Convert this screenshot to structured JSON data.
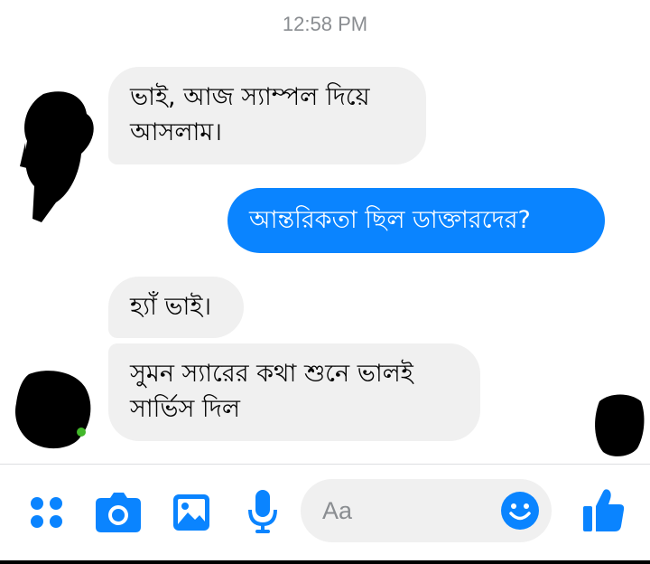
{
  "thread": {
    "timestamp": "12:58 PM",
    "messages": [
      {
        "direction": "incoming",
        "text": "ভাই, আজ স্যাম্পল দিয়ে আসলাম।"
      },
      {
        "direction": "outgoing",
        "text": "আন্তরিকতা ছিল ডাক্তারদের?"
      },
      {
        "direction": "incoming",
        "text": "হ্যাঁ ভাই।"
      },
      {
        "direction": "incoming",
        "text": "সুমন স্যারের কথা শুনে ভালই সার্ভিস দিল"
      }
    ]
  },
  "composer": {
    "placeholder": "Aa",
    "icons": [
      "apps-icon",
      "camera-icon",
      "gallery-icon",
      "microphone-icon",
      "emoji-icon",
      "like-icon"
    ]
  },
  "colors": {
    "accent": "#0a84ff",
    "incoming_bubble": "#f0f0f0",
    "timestamp": "#8a8d91"
  }
}
